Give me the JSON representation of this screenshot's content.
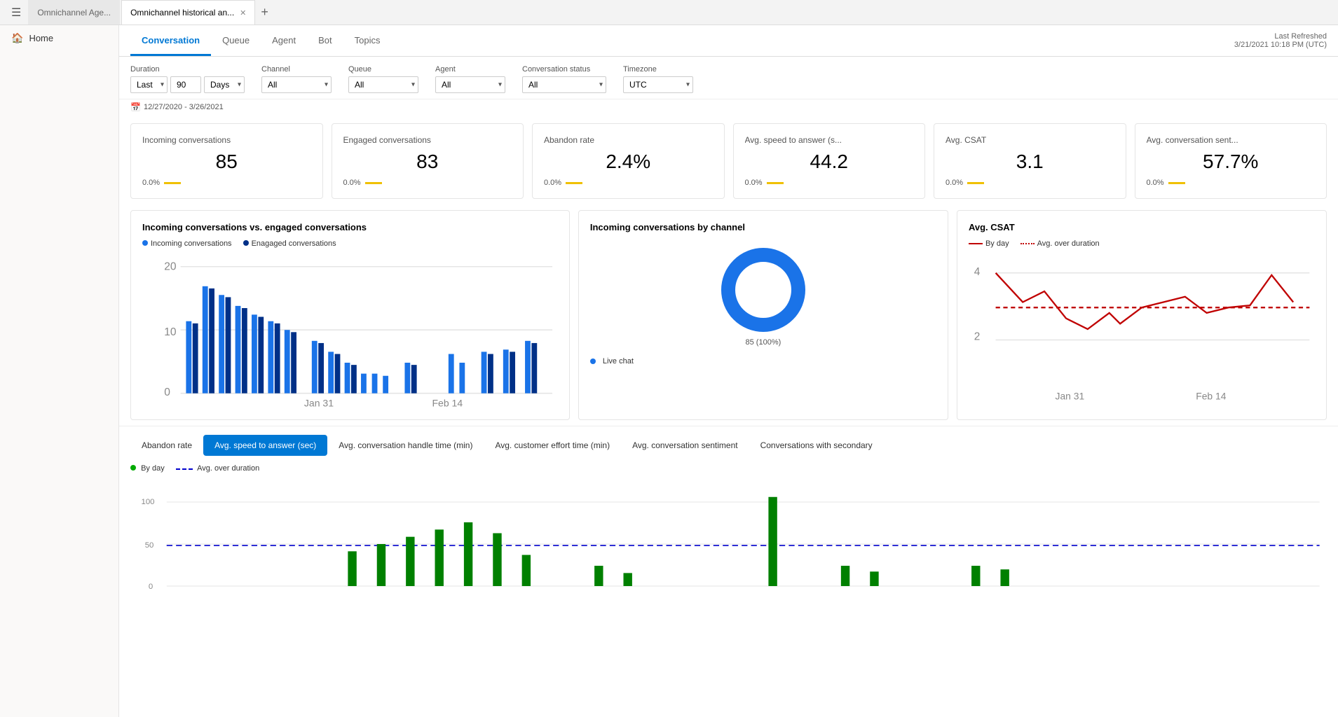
{
  "tabBar": {
    "tabs": [
      {
        "id": "tab1",
        "label": "Omnichannel Age...",
        "active": false,
        "closeable": false
      },
      {
        "id": "tab2",
        "label": "Omnichannel historical an...",
        "active": true,
        "closeable": true
      }
    ],
    "addTab": "+"
  },
  "sidebar": {
    "items": [
      {
        "id": "home",
        "label": "Home",
        "icon": "🏠"
      }
    ]
  },
  "header": {
    "lastRefreshedLabel": "Last Refreshed",
    "lastRefreshedValue": "3/21/2021 10:18 PM (UTC)"
  },
  "navTabs": [
    {
      "id": "conversation",
      "label": "Conversation",
      "active": true
    },
    {
      "id": "queue",
      "label": "Queue",
      "active": false
    },
    {
      "id": "agent",
      "label": "Agent",
      "active": false
    },
    {
      "id": "bot",
      "label": "Bot",
      "active": false
    },
    {
      "id": "topics",
      "label": "Topics",
      "active": false
    }
  ],
  "filters": {
    "duration": {
      "label": "Duration",
      "preset": "Last",
      "value": "90",
      "unit": "Days"
    },
    "channel": {
      "label": "Channel",
      "value": "All"
    },
    "queue": {
      "label": "Queue",
      "value": "All"
    },
    "agent": {
      "label": "Agent",
      "value": "All"
    },
    "conversationStatus": {
      "label": "Conversation status",
      "value": "All"
    },
    "timezone": {
      "label": "Timezone",
      "value": "UTC"
    },
    "dateRange": "12/27/2020 - 3/26/2021"
  },
  "kpiCards": [
    {
      "id": "incoming",
      "title": "Incoming conversations",
      "value": "85",
      "change": "0.0%",
      "hasBar": true
    },
    {
      "id": "engaged",
      "title": "Engaged conversations",
      "value": "83",
      "change": "0.0%",
      "hasBar": true
    },
    {
      "id": "abandon",
      "title": "Abandon rate",
      "value": "2.4%",
      "change": "0.0%",
      "hasBar": true
    },
    {
      "id": "speed",
      "title": "Avg. speed to answer (s...",
      "value": "44.2",
      "change": "0.0%",
      "hasBar": true
    },
    {
      "id": "csat",
      "title": "Avg. CSAT",
      "value": "3.1",
      "change": "0.0%",
      "hasBar": true
    },
    {
      "id": "sentiment",
      "title": "Avg. conversation sent...",
      "value": "57.7%",
      "change": "0.0%",
      "hasBar": true
    }
  ],
  "charts": {
    "barChart": {
      "title": "Incoming conversations vs. engaged conversations",
      "legend": [
        {
          "label": "Incoming conversations",
          "color": "#1a73e8"
        },
        {
          "label": "Enagaged conversations",
          "color": "#003087"
        }
      ],
      "xLabels": [
        "Jan 31",
        "Feb 14"
      ],
      "yMax": 20,
      "yMid": 10,
      "yMin": 0
    },
    "donutChart": {
      "title": "Incoming conversations by channel",
      "value": 85,
      "percent": "100%",
      "segments": [
        {
          "label": "Live chat",
          "color": "#1a73e8",
          "value": 85
        }
      ]
    },
    "lineChart": {
      "title": "Avg. CSAT",
      "legend": [
        {
          "label": "By day",
          "color": "#c00000",
          "style": "solid"
        },
        {
          "label": "Avg. over duration",
          "color": "#c00000",
          "style": "dotted"
        }
      ],
      "xLabels": [
        "Jan 31",
        "Feb 14"
      ],
      "yMax": 4,
      "yMin": 2
    }
  },
  "bottomTabs": [
    {
      "id": "abandon",
      "label": "Abandon rate",
      "active": false
    },
    {
      "id": "speed",
      "label": "Avg. speed to answer (sec)",
      "active": true
    },
    {
      "id": "handle",
      "label": "Avg. conversation handle time (min)",
      "active": false
    },
    {
      "id": "effort",
      "label": "Avg. customer effort time (min)",
      "active": false
    },
    {
      "id": "sentiment",
      "label": "Avg. conversation sentiment",
      "active": false
    },
    {
      "id": "secondary",
      "label": "Conversations with secondary",
      "active": false
    }
  ],
  "bottomChart": {
    "legend": [
      {
        "label": "By day",
        "type": "circle",
        "color": "#008000"
      },
      {
        "label": "Avg. over duration",
        "type": "dashed",
        "color": "#0000cc"
      }
    ],
    "yLabels": [
      "100",
      "50",
      "0"
    ],
    "avgLine": 47
  }
}
